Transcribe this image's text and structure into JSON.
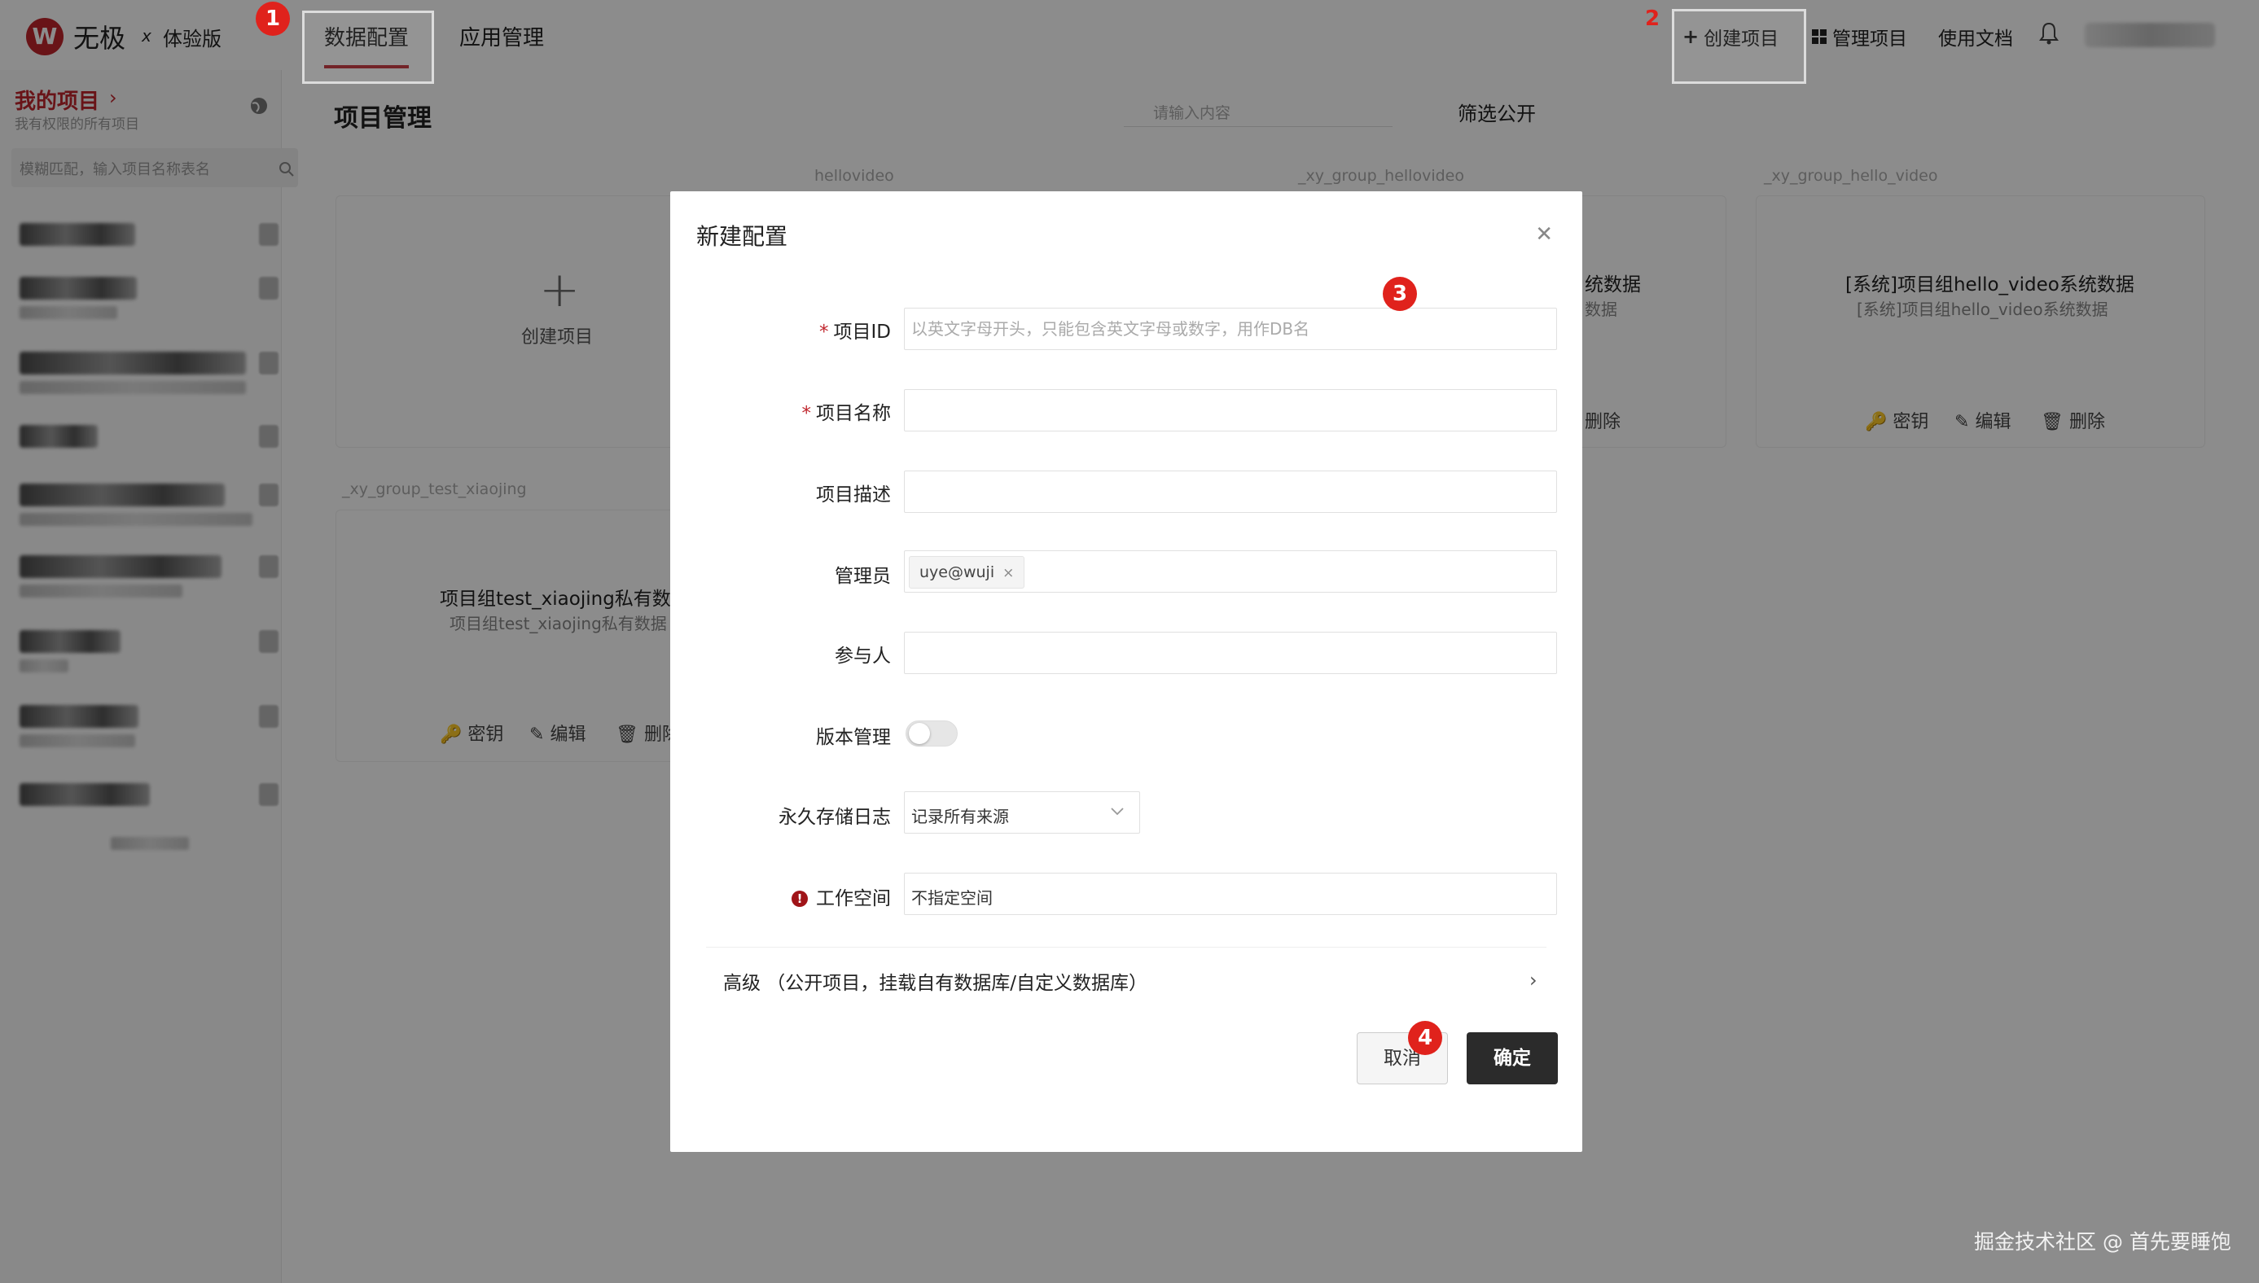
{
  "app": {
    "logo_letter": "W",
    "name": "无极",
    "name_mark": "x",
    "edition": "体验版"
  },
  "nav": {
    "tabs": [
      {
        "label": "数据配置",
        "active": true
      },
      {
        "label": "应用管理",
        "active": false
      }
    ],
    "right": {
      "create": "创建项目",
      "manage": "管理项目",
      "docs": "使用文档"
    }
  },
  "sidebar": {
    "title": "我的项目",
    "subtitle": "我有权限的所有项目",
    "search_placeholder": "模糊匹配，输入项目名称表名"
  },
  "main": {
    "title": "项目管理",
    "search_placeholder": "请输入内容",
    "filter_label": "筛选公开",
    "cards": [
      {
        "id": "hellovideo",
        "create_label": "创建项目"
      },
      {
        "id": "_xy_group_hellovideo",
        "name": "统数据",
        "desc": "数据",
        "action": "删除"
      },
      {
        "id": "_xy_group_hello_video",
        "name": "[系统]项目组hello_video系统数据",
        "desc": "[系统]项目组hello_video系统数据",
        "actions": [
          "密钥",
          "编辑",
          "删除"
        ]
      },
      {
        "id": "_xy_group_test_xiaojing",
        "name": "项目组test_xiaojing私有数据",
        "desc": "项目组test_xiaojing私有数据",
        "actions": [
          "密钥",
          "编辑",
          "删除"
        ]
      }
    ]
  },
  "dialog": {
    "title": "新建配置",
    "fields": {
      "project_id": {
        "label": "项目ID",
        "required": true,
        "value": "",
        "placeholder": "以英文字母开头，只能包含英文字母或数字，用作DB名"
      },
      "project_name": {
        "label": "项目名称",
        "required": true,
        "value": ""
      },
      "project_desc": {
        "label": "项目描述",
        "value": ""
      },
      "admins": {
        "label": "管理员",
        "tags": [
          "uye@wuji"
        ]
      },
      "participants": {
        "label": "参与人",
        "value": ""
      },
      "versioning": {
        "label": "版本管理",
        "enabled": false
      },
      "log_storage": {
        "label": "永久存储日志",
        "selected": "记录所有来源"
      },
      "workspace": {
        "label": "工作空间",
        "value": "不指定空间",
        "status": "error"
      }
    },
    "advanced": "高级 （公开项目，挂载自有数据库/自定义数据库）",
    "cancel": "取消",
    "confirm": "确定"
  },
  "steps": [
    "1",
    "2",
    "3",
    "4"
  ],
  "watermark": "掘金技术社区 @ 首先要睡饱",
  "colors": {
    "brand": "#c0262d",
    "step_marker": "#e0221c",
    "confirm_button": "#2b2b2b",
    "error_icon": "#a01418"
  }
}
